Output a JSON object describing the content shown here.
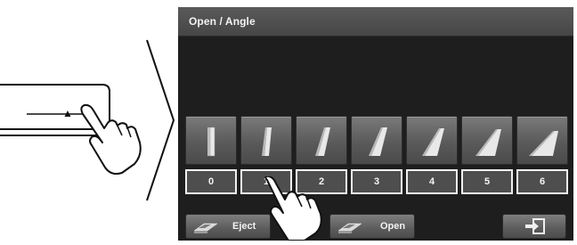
{
  "screen": {
    "title": "Open / Angle",
    "angle_options": [
      {
        "label": "0",
        "selected": false
      },
      {
        "label": "1",
        "selected": true
      },
      {
        "label": "2",
        "selected": false
      },
      {
        "label": "3",
        "selected": false
      },
      {
        "label": "4",
        "selected": false
      },
      {
        "label": "5",
        "selected": false
      },
      {
        "label": "6",
        "selected": false
      }
    ],
    "buttons": {
      "eject_label": "Eject",
      "open_label": "Open",
      "exit_icon": "exit-icon"
    }
  },
  "device": {
    "eject_symbol": "▲"
  },
  "icons": [
    "eject-icon",
    "pointing-hand-icon",
    "arrow-right-icon",
    "disc-tray-icon",
    "exit-icon"
  ]
}
